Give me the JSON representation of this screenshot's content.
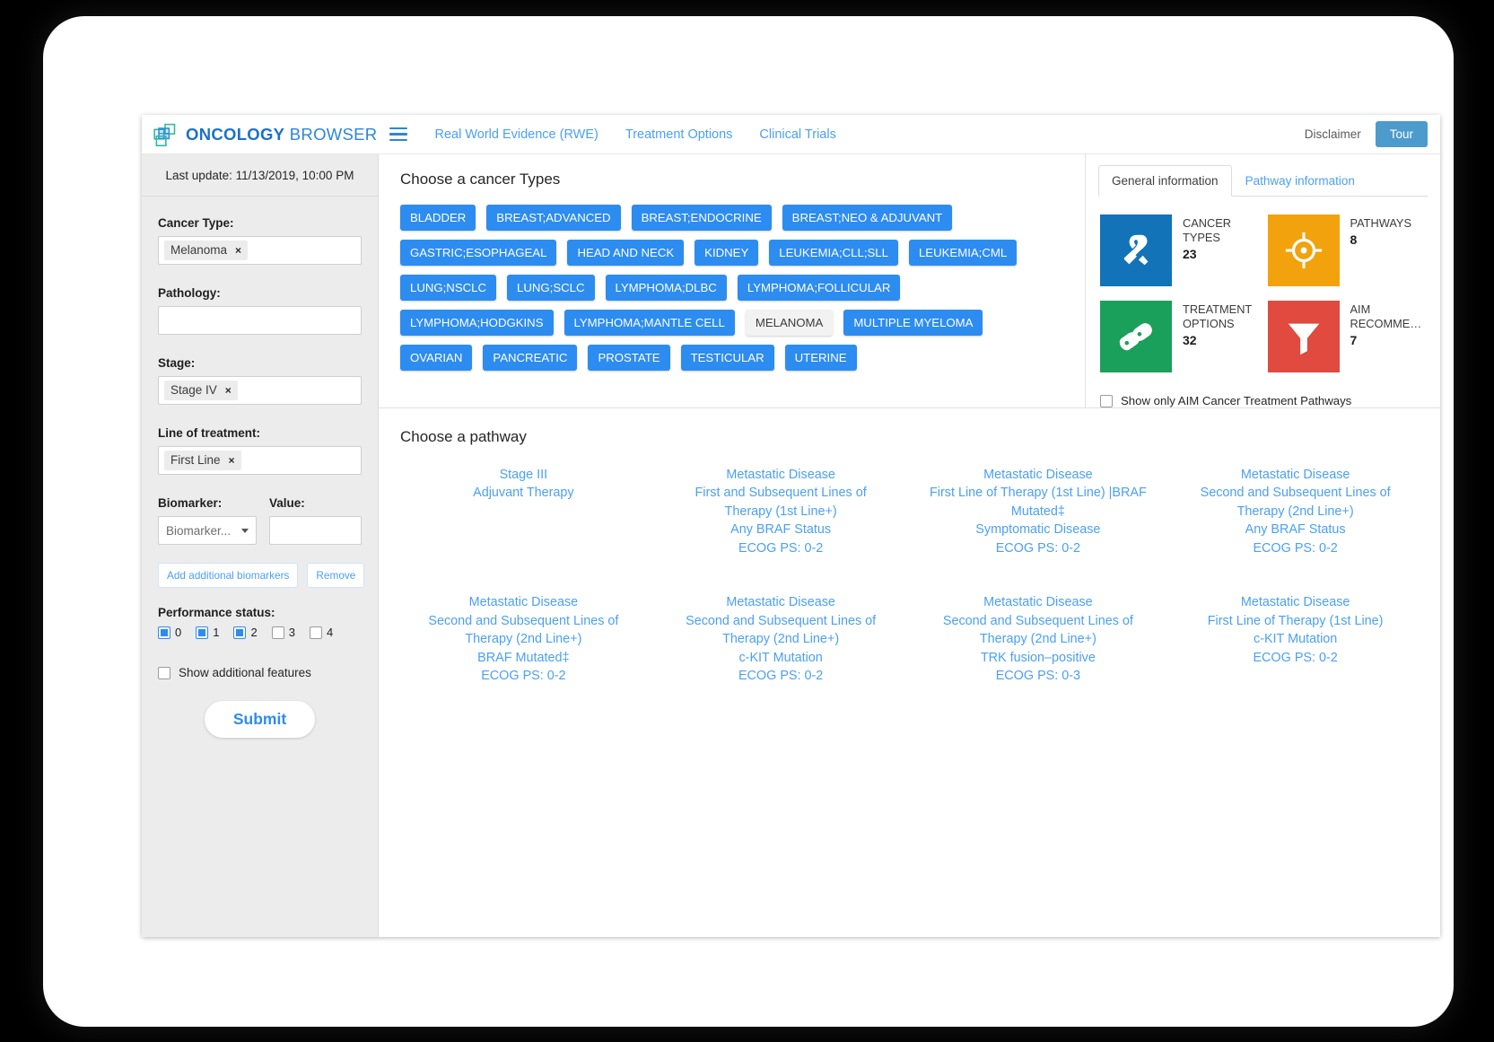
{
  "brand": {
    "name_bold": "ONCOLOGY",
    "name_light": "BROWSER",
    "logo_icon": "overlapping-squares-logo"
  },
  "topnav": {
    "menu_icon": "hamburger-icon",
    "links": [
      {
        "label": "Real World Evidence (RWE)"
      },
      {
        "label": "Treatment Options"
      },
      {
        "label": "Clinical Trials"
      }
    ],
    "disclaimer_label": "Disclaimer",
    "tour_label": "Tour",
    "tour_color": "#4d9bcc"
  },
  "sidebar": {
    "last_update": "Last update: 11/13/2019, 10:00 PM",
    "cancer_type": {
      "label": "Cancer Type:",
      "chip": "Melanoma",
      "remove_icon": "×"
    },
    "pathology": {
      "label": "Pathology:",
      "value": "",
      "placeholder": ""
    },
    "stage": {
      "label": "Stage:",
      "chip": "Stage IV",
      "remove_icon": "×"
    },
    "line_of_treatment": {
      "label": "Line of treatment:",
      "chip": "First Line",
      "remove_icon": "×"
    },
    "biomarker": {
      "label": "Biomarker:",
      "selected": "Biomarker...",
      "caret_icon": "chevron-down-icon"
    },
    "value": {
      "label": "Value:",
      "value": "",
      "placeholder": ""
    },
    "add_biomarkers_label": "Add additional biomarkers",
    "remove_label": "Remove",
    "performance_status": {
      "label": "Performance status:",
      "options": [
        {
          "num": "0",
          "checked": true
        },
        {
          "num": "1",
          "checked": true
        },
        {
          "num": "2",
          "checked": true
        },
        {
          "num": "3",
          "checked": false
        },
        {
          "num": "4",
          "checked": false
        }
      ]
    },
    "show_additional_features": {
      "label": "Show additional features",
      "checked": false
    },
    "submit_label": "Submit"
  },
  "main": {
    "cancer_types_title": "Choose a cancer Types",
    "cancer_types": [
      {
        "label": "BLADDER",
        "selected": false
      },
      {
        "label": "BREAST;ADVANCED",
        "selected": false
      },
      {
        "label": "BREAST;ENDOCRINE",
        "selected": false
      },
      {
        "label": "BREAST;NEO & ADJUVANT",
        "selected": false
      },
      {
        "label": "GASTRIC;ESOPHAGEAL",
        "selected": false
      },
      {
        "label": "HEAD AND NECK",
        "selected": false
      },
      {
        "label": "KIDNEY",
        "selected": false
      },
      {
        "label": "LEUKEMIA;CLL;SLL",
        "selected": false
      },
      {
        "label": "LEUKEMIA;CML",
        "selected": false
      },
      {
        "label": "LUNG;NSCLC",
        "selected": false
      },
      {
        "label": "LUNG;SCLC",
        "selected": false
      },
      {
        "label": "LYMPHOMA;DLBC",
        "selected": false
      },
      {
        "label": "LYMPHOMA;FOLLICULAR",
        "selected": false
      },
      {
        "label": "LYMPHOMA;HODGKINS",
        "selected": false
      },
      {
        "label": "LYMPHOMA;MANTLE CELL",
        "selected": false
      },
      {
        "label": "MELANOMA",
        "selected": true
      },
      {
        "label": "MULTIPLE MYELOMA",
        "selected": false
      },
      {
        "label": "OVARIAN",
        "selected": false
      },
      {
        "label": "PANCREATIC",
        "selected": false
      },
      {
        "label": "PROSTATE",
        "selected": false
      },
      {
        "label": "TESTICULAR",
        "selected": false
      },
      {
        "label": "UTERINE",
        "selected": false
      }
    ],
    "pathway_title": "Choose a pathway",
    "pathways": [
      {
        "lines": [
          "Stage III",
          "Adjuvant Therapy"
        ]
      },
      {
        "lines": [
          "Metastatic Disease",
          "First and Subsequent Lines of Therapy (1st Line+)",
          "Any BRAF Status",
          "ECOG PS: 0-2"
        ]
      },
      {
        "lines": [
          "Metastatic Disease",
          "First Line of Therapy (1st Line) |BRAF Mutated‡",
          "Symptomatic Disease",
          "ECOG PS: 0-2"
        ]
      },
      {
        "lines": [
          "Metastatic Disease",
          "Second and Subsequent Lines of Therapy (2nd Line+)",
          "Any BRAF Status",
          "ECOG PS: 0-2"
        ]
      },
      {
        "lines": [
          "Metastatic Disease",
          "Second and Subsequent Lines of Therapy (2nd Line+)",
          "BRAF Mutated‡",
          "ECOG PS: 0-2"
        ]
      },
      {
        "lines": [
          "Metastatic Disease",
          "Second and Subsequent Lines of Therapy (2nd Line+)",
          "c-KIT Mutation",
          "ECOG PS: 0-2"
        ]
      },
      {
        "lines": [
          "Metastatic Disease",
          "Second and Subsequent Lines of Therapy (2nd Line+)",
          "TRK fusion–positive",
          "ECOG PS: 0-3"
        ]
      },
      {
        "lines": [
          "Metastatic Disease",
          "First Line of Therapy (1st Line)",
          "c-KIT Mutation",
          "ECOG PS: 0-2"
        ]
      }
    ]
  },
  "info_panel": {
    "tabs": [
      {
        "label": "General information",
        "active": true
      },
      {
        "label": "Pathway information",
        "active": false
      }
    ],
    "stats": [
      {
        "label": "CANCER TYPES",
        "value": "23",
        "color": "#1273b8",
        "icon": "ribbon-icon"
      },
      {
        "label": "PATHWAYS",
        "value": "8",
        "color": "#f2a20c",
        "icon": "target-icon"
      },
      {
        "label": "TREATMENT OPTIONS",
        "value": "32",
        "color": "#1aa05a",
        "icon": "pills-icon"
      },
      {
        "label": "AIM RECOMME…",
        "value": "7",
        "color": "#e04a3f",
        "icon": "funnel-icon"
      }
    ],
    "aim_checkbox": {
      "label": "Show only AIM Cancer Treatment Pathways",
      "checked": false
    }
  }
}
